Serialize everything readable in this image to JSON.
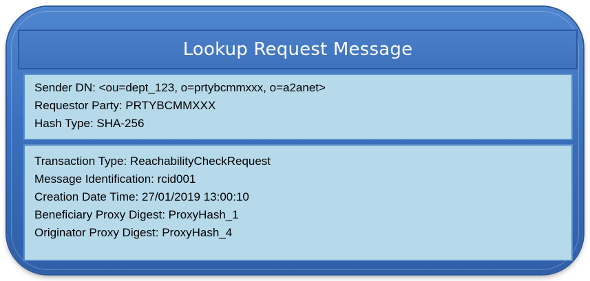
{
  "title": "Lookup Request Message",
  "header_fields": [
    {
      "label": "Sender DN",
      "value": "<ou=dept_123, o=prtybcmmxxx, o=a2anet>"
    },
    {
      "label": "Requestor Party",
      "value": "PRTYBCMMXXX"
    },
    {
      "label": "Hash Type",
      "value": "SHA-256"
    }
  ],
  "body_fields": [
    {
      "label": "Transaction Type",
      "value": "ReachabilityCheckRequest"
    },
    {
      "label": "Message Identification",
      "value": "rcid001"
    },
    {
      "label": "Creation Date Time",
      "value": "27/01/2019 13:00:10"
    },
    {
      "label": "Beneficiary Proxy Digest",
      "value": "ProxyHash_1"
    },
    {
      "label": "Originator Proxy Digest",
      "value": "ProxyHash_4"
    }
  ],
  "colors": {
    "frame": "#3a6fbd",
    "panel": "#b7daeb",
    "panel_border": "#5a8fc8"
  }
}
